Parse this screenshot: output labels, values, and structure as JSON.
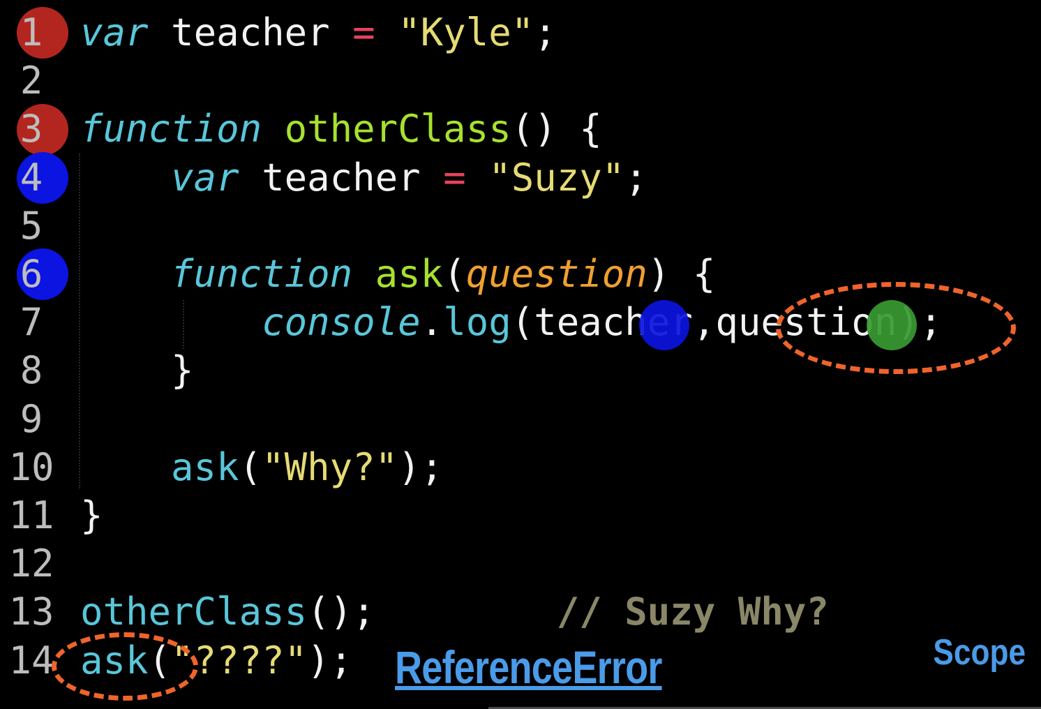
{
  "lines": [
    {
      "n": "1",
      "tokens": [
        [
          "kw",
          "var"
        ],
        [
          "id",
          " teacher "
        ],
        [
          "op",
          "="
        ],
        [
          "id",
          " "
        ],
        [
          "str",
          "\"Kyle\""
        ],
        [
          "id",
          ";"
        ]
      ]
    },
    {
      "n": "2",
      "tokens": []
    },
    {
      "n": "3",
      "tokens": [
        [
          "kw",
          "function"
        ],
        [
          "id",
          " "
        ],
        [
          "fn",
          "otherClass"
        ],
        [
          "id",
          "() {"
        ]
      ]
    },
    {
      "n": "4",
      "tokens": [
        [
          "id",
          "    "
        ],
        [
          "kw",
          "var"
        ],
        [
          "id",
          " teacher "
        ],
        [
          "op",
          "="
        ],
        [
          "id",
          " "
        ],
        [
          "str",
          "\"Suzy\""
        ],
        [
          "id",
          ";"
        ]
      ]
    },
    {
      "n": "5",
      "tokens": []
    },
    {
      "n": "6",
      "tokens": [
        [
          "id",
          "    "
        ],
        [
          "kw",
          "function"
        ],
        [
          "id",
          " "
        ],
        [
          "fn",
          "ask"
        ],
        [
          "id",
          "("
        ],
        [
          "param",
          "question"
        ],
        [
          "id",
          ") {"
        ]
      ]
    },
    {
      "n": "7",
      "tokens": [
        [
          "id",
          "        "
        ],
        [
          "kw",
          "console"
        ],
        [
          "id",
          "."
        ],
        [
          "call",
          "log"
        ],
        [
          "id",
          "(teacher,question);"
        ]
      ]
    },
    {
      "n": "8",
      "tokens": [
        [
          "id",
          "    }"
        ]
      ]
    },
    {
      "n": "9",
      "tokens": []
    },
    {
      "n": "10",
      "tokens": [
        [
          "id",
          "    "
        ],
        [
          "call",
          "ask"
        ],
        [
          "id",
          "("
        ],
        [
          "str",
          "\"Why?\""
        ],
        [
          "id",
          ");"
        ]
      ]
    },
    {
      "n": "11",
      "tokens": [
        [
          "id",
          "}"
        ]
      ]
    },
    {
      "n": "12",
      "tokens": []
    },
    {
      "n": "13",
      "tokens": [
        [
          "call",
          "otherClass"
        ],
        [
          "id",
          "();"
        ],
        [
          "id",
          "        "
        ],
        [
          "comment",
          "// Suzy Why?"
        ]
      ]
    },
    {
      "n": "14",
      "tokens": [
        [
          "call",
          "ask"
        ],
        [
          "id",
          "("
        ],
        [
          "str",
          "\"????\""
        ],
        [
          "id",
          ");"
        ]
      ]
    }
  ],
  "error_label": "ReferenceError",
  "scope_label": "Scope",
  "colors": {
    "marker_red": "#b3261f",
    "marker_blue": "#0b14e0",
    "marker_green": "#3a9a32",
    "annotation_orange": "#f0642c",
    "link_blue": "#4a9be8"
  },
  "icons": [
    "scope-marker-red",
    "scope-marker-blue",
    "variable-dot-blue",
    "variable-dot-green"
  ]
}
